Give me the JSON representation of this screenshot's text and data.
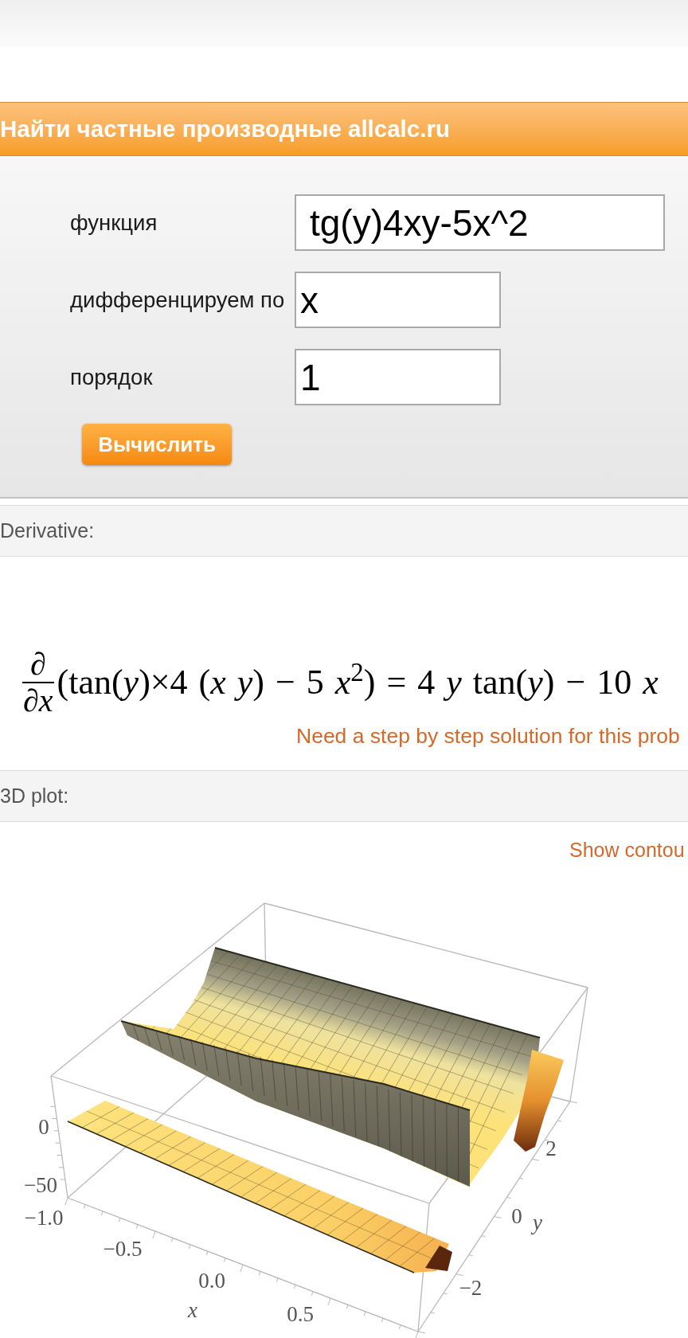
{
  "calculator": {
    "title": "Найти частные производные allcalc.ru",
    "fields": [
      {
        "label": "функция",
        "value": "tg(y)4xy-5x^2"
      },
      {
        "label": "дифференцируем по",
        "value": "x"
      },
      {
        "label": "порядок",
        "value": "1"
      }
    ],
    "submit_button": "Вычислить"
  },
  "derivative": {
    "heading": "Derivative:",
    "operator_numerator": "∂",
    "operator_denominator": "∂*x*",
    "expression": "(tan(*y*)×4 (*x* *y*) − 5 *x*$^{2}$) = 4 *y* tan(*y*) − 10 *x*",
    "step_link": "Need a step by step solution for this prob"
  },
  "plot_3d": {
    "heading": "3D plot:",
    "contour_link": "Show contou",
    "z_ticks": [
      "0",
      "−50"
    ],
    "x_ticks": [
      "−1.0",
      "−0.5",
      "0.0",
      "0.5"
    ],
    "y_ticks": [
      "2",
      "0",
      "−2"
    ],
    "x_label": "x",
    "y_label": "y"
  }
}
